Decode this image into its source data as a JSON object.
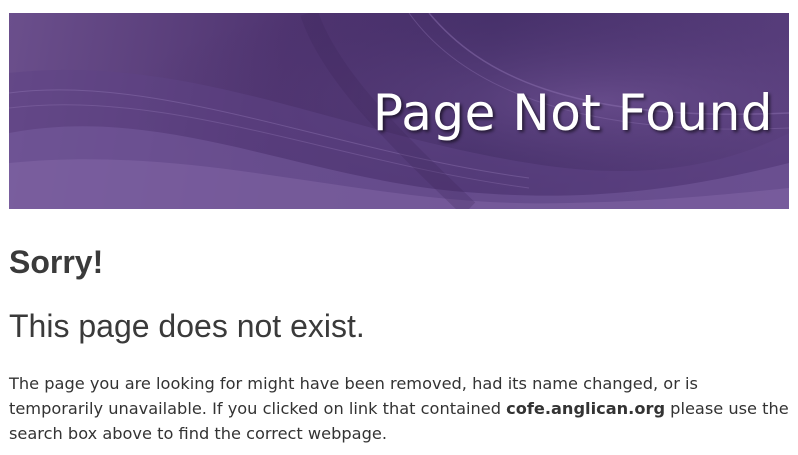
{
  "banner": {
    "title": "Page Not Found"
  },
  "main": {
    "heading": "Sorry!",
    "subheading": "This page does not exist.",
    "message": {
      "part1": "The page you are looking for might have been removed, had its name changed, or is temporarily unavailable. If you clicked on link that contained ",
      "domain": "cofe.anglican.org",
      "part2": " please use the search box above to find the correct webpage."
    }
  },
  "colors": {
    "banner_purple": "#4f3470",
    "text": "#3a3a3a"
  }
}
